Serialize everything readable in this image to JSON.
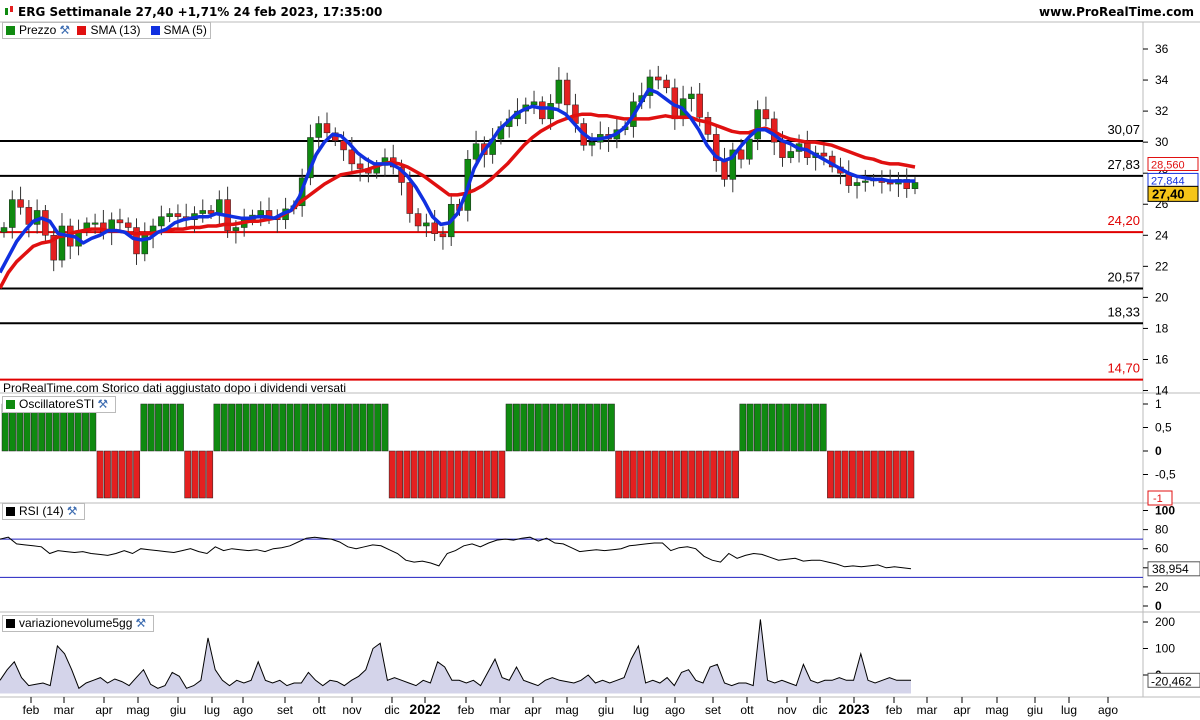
{
  "header": {
    "title": "ERG Settimanale 27,40 +1,71% 24 feb 2023, 17:35:00",
    "site": "www.ProRealTime.com"
  },
  "legend": {
    "price": "Prezzo",
    "sma13": "SMA (13)",
    "sma5": "SMA (5)",
    "oscillator": "OscillatoreSTI",
    "rsi": "RSI (14)",
    "volume": "variazionevolume5gg"
  },
  "footnote": "ProRealTime.com  Storico dati aggiustato dopo i dividendi versati",
  "colors": {
    "up": "#0f8a10",
    "down": "#e42020",
    "sma13": "#e01010",
    "sma5": "#1030e0",
    "support_black": "#000000",
    "support_red": "#e00000"
  },
  "chart_data": [
    {
      "type": "candlestick",
      "panel": "price",
      "y_ticks": [
        14,
        16,
        18,
        20,
        22,
        24,
        26,
        28,
        30,
        32,
        34,
        36
      ],
      "ylim": [
        13.6,
        37.4
      ],
      "levels": [
        {
          "label": "30,07",
          "value": 30.07,
          "color": "black"
        },
        {
          "label": "27,83",
          "value": 27.83,
          "color": "black"
        },
        {
          "label": "24,20",
          "value": 24.2,
          "color": "red"
        },
        {
          "label": "20,57",
          "value": 20.57,
          "color": "black"
        },
        {
          "label": "18,33",
          "value": 18.33,
          "color": "black"
        },
        {
          "label": "14,70",
          "value": 14.7,
          "color": "red"
        }
      ],
      "last_values": {
        "sma13": "28,560",
        "sma5": "27,844",
        "price": "27,40"
      },
      "x_labels": [
        "feb",
        "mar",
        "apr",
        "mag",
        "giu",
        "lug",
        "ago",
        "set",
        "ott",
        "nov",
        "dic",
        "2022",
        "feb",
        "mar",
        "apr",
        "mag",
        "giu",
        "lug",
        "ago",
        "set",
        "ott",
        "nov",
        "dic",
        "2023",
        "feb",
        "mar",
        "apr",
        "mag",
        "giu",
        "lug",
        "ago"
      ],
      "close": [
        24.5,
        26.3,
        25.8,
        24.7,
        25.6,
        24.0,
        22.4,
        24.6,
        23.3,
        24.3,
        24.8,
        24.8,
        24.2,
        25.0,
        24.8,
        24.5,
        22.8,
        24.0,
        24.6,
        25.2,
        25.4,
        25.2,
        25.0,
        25.4,
        25.6,
        25.4,
        26.3,
        24.3,
        24.5,
        25.0,
        25.3,
        25.6,
        25.2,
        25.0,
        25.7,
        25.9,
        27.7,
        30.3,
        31.2,
        30.6,
        30.1,
        29.5,
        28.6,
        28.3,
        28.0,
        28.5,
        29.0,
        28.4,
        27.4,
        25.4,
        24.6,
        24.8,
        24.1,
        23.9,
        26.0,
        25.6,
        28.9,
        29.9,
        29.2,
        30.2,
        31.0,
        31.5,
        32.0,
        32.4,
        32.6,
        31.5,
        32.5,
        34.0,
        32.4,
        31.2,
        29.8,
        30.0,
        30.5,
        30.2,
        30.8,
        31.0,
        32.6,
        33.0,
        34.2,
        34.0,
        33.5,
        31.5,
        32.8,
        33.1,
        31.6,
        30.5,
        28.8,
        27.6,
        29.5,
        28.9,
        30.2,
        32.1,
        31.5,
        30.0,
        29.0,
        29.4,
        29.9,
        29.0,
        29.3,
        29.1,
        28.4,
        28.0,
        27.2,
        27.4,
        27.5,
        27.6,
        27.4,
        27.3,
        27.6,
        27.0,
        27.4
      ],
      "sma13": [
        20.6,
        21.6,
        22.3,
        22.8,
        23.3,
        23.5,
        23.6,
        23.9,
        24.0,
        24.2,
        24.3,
        24.4,
        24.4,
        24.3,
        24.3,
        24.2,
        24.1,
        24.1,
        24.1,
        24.2,
        24.3,
        24.4,
        24.4,
        24.5,
        24.5,
        24.6,
        24.6,
        24.7,
        24.7,
        24.8,
        24.9,
        24.9,
        25.0,
        25.1,
        25.3,
        25.6,
        26.1,
        26.5,
        26.9,
        27.3,
        27.6,
        27.9,
        28.0,
        28.1,
        28.2,
        28.4,
        28.6,
        28.7,
        28.6,
        28.4,
        28.1,
        27.8,
        27.4,
        27.0,
        26.6,
        26.6,
        26.7,
        26.9,
        27.2,
        27.6,
        28.1,
        28.6,
        29.2,
        29.8,
        30.3,
        30.7,
        31.0,
        31.3,
        31.5,
        31.7,
        31.8,
        31.8,
        31.7,
        31.7,
        31.6,
        31.5,
        31.5,
        31.5,
        31.5,
        31.6,
        31.7,
        31.6,
        31.6,
        31.6,
        31.4,
        31.3,
        31.1,
        30.9,
        30.7,
        30.6,
        30.6,
        30.8,
        30.9,
        30.7,
        30.4,
        30.2,
        30.1,
        30.0,
        30.0,
        29.9,
        29.8,
        29.6,
        29.4,
        29.2,
        29.0,
        28.9,
        28.7,
        28.6,
        28.6,
        28.5,
        28.4
      ],
      "sma5": [
        21.6,
        22.6,
        23.6,
        24.3,
        24.9,
        25.1,
        24.9,
        24.1,
        24.0,
        23.9,
        23.5,
        23.8,
        24.0,
        24.3,
        24.3,
        24.2,
        23.8,
        23.7,
        23.8,
        24.2,
        24.4,
        24.8,
        25.0,
        25.1,
        25.2,
        25.2,
        25.4,
        25.3,
        25.2,
        25.1,
        25.1,
        25.2,
        25.2,
        25.1,
        25.4,
        25.6,
        26.5,
        27.9,
        29.2,
        30.0,
        30.5,
        30.4,
        29.9,
        29.3,
        28.9,
        28.6,
        28.6,
        28.6,
        28.3,
        27.8,
        27.1,
        26.2,
        25.2,
        24.7,
        24.8,
        25.4,
        26.7,
        28.3,
        29.3,
        30.0,
        30.8,
        31.3,
        31.8,
        32.1,
        32.3,
        32.2,
        32.2,
        32.1,
        31.8,
        31.2,
        30.6,
        30.2,
        30.2,
        30.3,
        30.5,
        30.9,
        31.6,
        32.5,
        33.4,
        33.2,
        32.8,
        32.4,
        32.2,
        31.6,
        30.8,
        29.8,
        29.1,
        28.8,
        29.0,
        29.7,
        30.3,
        30.8,
        30.8,
        30.5,
        30.1,
        29.9,
        29.6,
        29.5,
        29.2,
        28.9,
        28.6,
        28.3,
        28.0,
        27.8,
        27.7,
        27.6,
        27.6,
        27.5,
        27.5,
        27.5,
        27.5
      ]
    },
    {
      "type": "bar",
      "panel": "oscillator",
      "y_ticks": [
        "1",
        "0,5",
        "0",
        "-0,5"
      ],
      "last_value": "-1",
      "values": [
        1,
        1,
        1,
        1,
        1,
        1,
        1,
        1,
        1,
        1,
        1,
        1,
        1,
        -1,
        -1,
        -1,
        -1,
        -1,
        -1,
        1,
        1,
        1,
        1,
        1,
        1,
        -1,
        -1,
        -1,
        -1,
        1,
        1,
        1,
        1,
        1,
        1,
        1,
        1,
        1,
        1,
        1,
        1,
        1,
        1,
        1,
        1,
        1,
        1,
        1,
        1,
        1,
        1,
        1,
        1,
        -1,
        -1,
        -1,
        -1,
        -1,
        -1,
        -1,
        -1,
        -1,
        -1,
        -1,
        -1,
        -1,
        -1,
        -1,
        -1,
        1,
        1,
        1,
        1,
        1,
        1,
        1,
        1,
        1,
        1,
        1,
        1,
        1,
        1,
        1,
        -1,
        -1,
        -1,
        -1,
        -1,
        -1,
        -1,
        -1,
        -1,
        -1,
        -1,
        -1,
        -1,
        -1,
        -1,
        -1,
        -1,
        1,
        1,
        1,
        1,
        1,
        1,
        1,
        1,
        1,
        1,
        1,
        1,
        -1,
        -1,
        -1,
        -1,
        -1,
        -1,
        -1,
        -1,
        -1,
        -1,
        -1,
        -1
      ]
    },
    {
      "type": "line",
      "panel": "rsi",
      "y_ticks": [
        0,
        20,
        40,
        60,
        80,
        100
      ],
      "bands": [
        30,
        70
      ],
      "last_value": "38,954",
      "values": [
        70,
        72,
        65,
        64,
        63,
        62,
        55,
        58,
        57,
        56,
        57,
        55,
        54,
        53,
        55,
        58,
        55,
        60,
        59,
        58,
        57,
        56,
        58,
        60,
        57,
        55,
        62,
        58,
        60,
        59,
        58,
        59,
        57,
        60,
        61,
        63,
        67,
        71,
        72,
        71,
        70,
        67,
        62,
        60,
        62,
        64,
        63,
        59,
        55,
        48,
        46,
        47,
        45,
        42,
        55,
        58,
        63,
        65,
        62,
        66,
        69,
        70,
        69,
        71,
        72,
        68,
        71,
        66,
        65,
        61,
        57,
        58,
        59,
        58,
        59,
        60,
        63,
        64,
        65,
        66,
        66,
        58,
        61,
        62,
        60,
        52,
        48,
        46,
        55,
        50,
        53,
        55,
        54,
        51,
        48,
        49,
        50,
        47,
        48,
        48,
        46,
        44,
        41,
        42,
        41,
        42,
        43,
        40,
        41,
        40,
        38.95
      ]
    },
    {
      "type": "area",
      "panel": "volume",
      "y_ticks": [
        0,
        100,
        200
      ],
      "last_value": "-20,462",
      "values": [
        -20,
        20,
        50,
        -10,
        -40,
        -35,
        -30,
        -40,
        110,
        80,
        20,
        -50,
        -30,
        -20,
        -10,
        -30,
        -15,
        -25,
        -40,
        -10,
        20,
        -35,
        -50,
        -40,
        10,
        -5,
        -50,
        -40,
        -20,
        140,
        20,
        -20,
        -40,
        -20,
        -30,
        -20,
        50,
        -20,
        -30,
        -20,
        -40,
        -30,
        -30,
        10,
        -20,
        -40,
        -20,
        -25,
        -40,
        -20,
        -5,
        20,
        100,
        120,
        -20,
        -10,
        -20,
        -30,
        -40,
        -20,
        -30,
        50,
        30,
        -20,
        -20,
        -30,
        -20,
        -40,
        10,
        60,
        -10,
        -20,
        30,
        -20,
        -30,
        -40,
        -20,
        -10,
        -20,
        -25,
        -30,
        -20,
        0,
        -30,
        -20,
        -30,
        -20,
        -10,
        60,
        110,
        -30,
        -20,
        -30,
        -10,
        -40,
        10,
        20,
        -20,
        -30,
        30,
        40,
        -30,
        -40,
        -30,
        -30,
        -40,
        210,
        -20,
        -30,
        -20,
        -30,
        -40,
        40,
        -20,
        -30,
        -20,
        -20,
        -10,
        -20,
        -20,
        80,
        -20,
        -30,
        -20,
        -10,
        -20,
        -20,
        -20
      ]
    }
  ]
}
